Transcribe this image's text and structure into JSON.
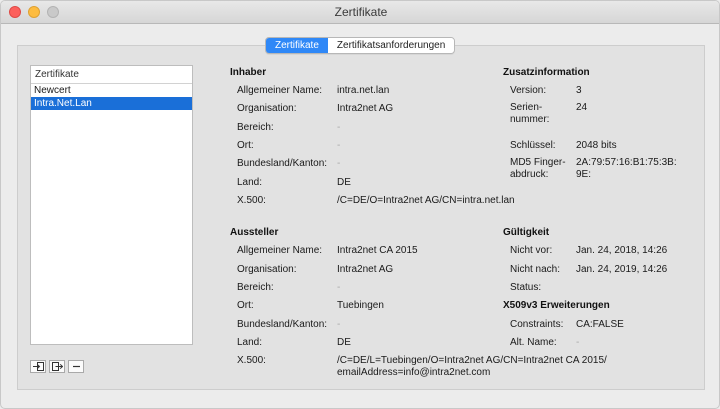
{
  "window": {
    "title": "Zertifikate"
  },
  "tabs": [
    {
      "label": "Zertifikate",
      "active": true
    },
    {
      "label": "Zertifikatsanforderungen",
      "active": false
    }
  ],
  "certificate_list": {
    "header": "Zertifikate",
    "items": [
      {
        "label": "Newcert",
        "selected": false
      },
      {
        "label": "Intra.Net.Lan",
        "selected": true
      }
    ]
  },
  "toolbar": {
    "import_icon": "import-icon",
    "export_icon": "export-icon",
    "remove_icon": "minus-icon"
  },
  "inhaber": {
    "title": "Inhaber",
    "rows": [
      {
        "label": "Allgemeiner Name:",
        "value": "intra.net.lan"
      },
      {
        "label": "Organisation:",
        "value": "Intra2net AG"
      },
      {
        "label": "Bereich:",
        "value": "-"
      },
      {
        "label": "Ort:",
        "value": "-"
      },
      {
        "label": "Bundesland/Kanton:",
        "value": "-"
      },
      {
        "label": "Land:",
        "value": "DE"
      },
      {
        "label": "X.500:",
        "value": "/C=DE/O=Intra2net AG/CN=intra.net.lan"
      }
    ]
  },
  "zusatz": {
    "title": "Zusatzinformation",
    "version_label": "Version:",
    "version_value": "3",
    "serial_label_1": "Serien-",
    "serial_label_2": "nummer:",
    "serial_value": "24",
    "key_label": "Schlüssel:",
    "key_value": "2048 bits",
    "md5_label_1": "MD5 Finger-",
    "md5_label_2": "abdruck:",
    "md5_value_1": "2A:79:57:16:B1:75:3B:",
    "md5_value_2": "9E:"
  },
  "aussteller": {
    "title": "Aussteller",
    "rows": [
      {
        "label": "Allgemeiner Name:",
        "value": "Intra2net CA 2015"
      },
      {
        "label": "Organisation:",
        "value": "Intra2net AG"
      },
      {
        "label": "Bereich:",
        "value": "-"
      },
      {
        "label": "Ort:",
        "value": "Tuebingen"
      },
      {
        "label": "Bundesland/Kanton:",
        "value": "-"
      },
      {
        "label": "Land:",
        "value": "DE"
      }
    ],
    "x500_label": "X.500:",
    "x500_value_1": "/C=DE/L=Tuebingen/O=Intra2net AG/CN=Intra2net CA 2015/",
    "x500_value_2": "emailAddress=info@intra2net.com"
  },
  "gueltigkeit": {
    "title": "Gültigkeit",
    "not_before_label": "Nicht vor:",
    "not_before_value": "Jan. 24, 2018, 14:26",
    "not_after_label": "Nicht nach:",
    "not_after_value": "Jan. 24, 2019, 14:26",
    "status_label": "Status:"
  },
  "x509": {
    "title": "X509v3 Erweiterungen",
    "constraints_label": "Constraints:",
    "constraints_value": "CA:FALSE",
    "altname_label": "Alt. Name:",
    "altname_value": "-"
  }
}
